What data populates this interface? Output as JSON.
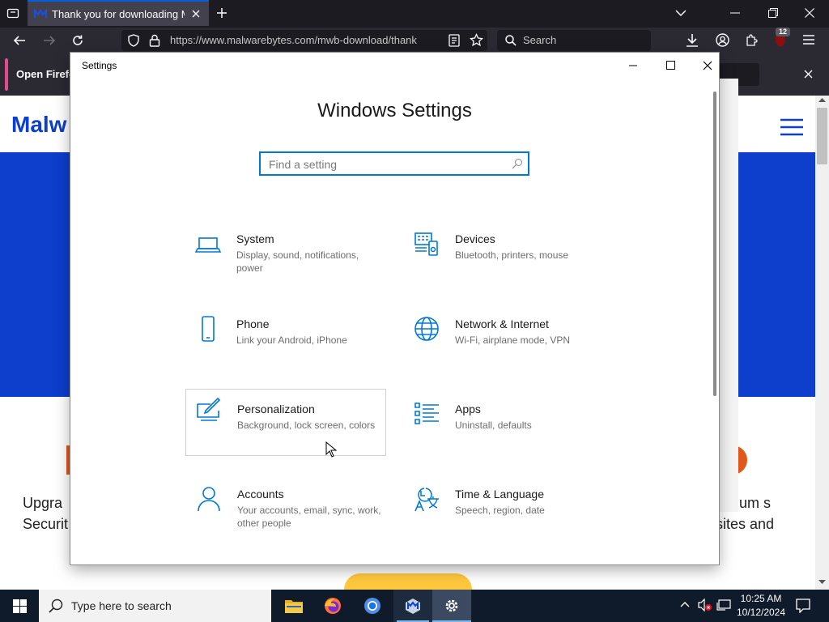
{
  "browser": {
    "tab_title": "Thank you for downloading Ma",
    "url": "https://www.malwarebytes.com/mwb-download/thank",
    "search_placeholder": "Search",
    "extension_badge": "12",
    "notification_text": "Open Firefo"
  },
  "website": {
    "logo_text": "Malw",
    "left_teaser": "Upgra Securit",
    "right_teaser": "emium s sites and"
  },
  "settings": {
    "window_title": "Settings",
    "heading": "Windows Settings",
    "search_placeholder": "Find a setting",
    "tiles": [
      {
        "title": "System",
        "desc": "Display, sound, notifications, power",
        "icon": "laptop-icon"
      },
      {
        "title": "Devices",
        "desc": "Bluetooth, printers, mouse",
        "icon": "devices-icon"
      },
      {
        "title": "Phone",
        "desc": "Link your Android, iPhone",
        "icon": "phone-icon"
      },
      {
        "title": "Network & Internet",
        "desc": "Wi-Fi, airplane mode, VPN",
        "icon": "globe-icon"
      },
      {
        "title": "Personalization",
        "desc": "Background, lock screen, colors",
        "icon": "paintbrush-icon"
      },
      {
        "title": "Apps",
        "desc": "Uninstall, defaults",
        "icon": "apps-list-icon"
      },
      {
        "title": "Accounts",
        "desc": "Your accounts, email, sync, work, other people",
        "icon": "person-icon"
      },
      {
        "title": "Time & Language",
        "desc": "Speech, region, date",
        "icon": "time-language-icon"
      }
    ]
  },
  "taskbar": {
    "search_placeholder": "Type here to search",
    "time": "10:25 AM",
    "date": "10/12/2024"
  },
  "colors": {
    "accent": "#0078d7",
    "brand_blue": "#0d3ecc",
    "firefox_dark": "#1c1b22"
  }
}
